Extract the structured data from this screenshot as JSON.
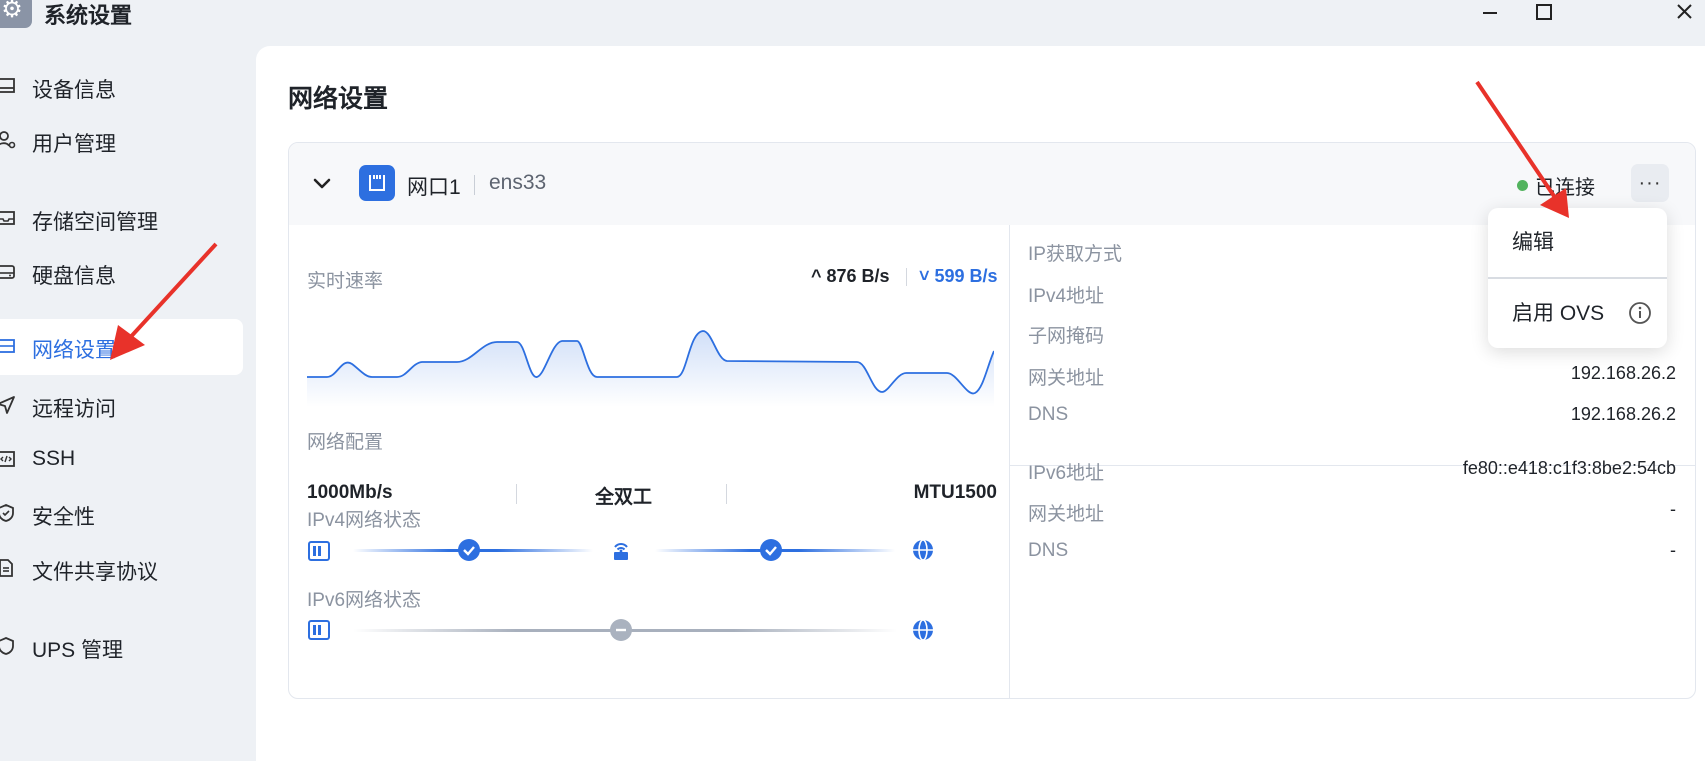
{
  "window": {
    "title": "系统设置",
    "icons": [
      "gear-icon",
      "minimize-icon",
      "maximize-icon",
      "close-icon"
    ]
  },
  "sidebar": {
    "items": [
      {
        "label": "设备信息",
        "icon": "device-icon"
      },
      {
        "label": "用户管理",
        "icon": "user-gear-icon"
      },
      {
        "label": "存储空间管理",
        "icon": "storage-icon"
      },
      {
        "label": "硬盘信息",
        "icon": "disk-icon"
      },
      {
        "label": "网络设置",
        "icon": "network-icon",
        "active": true
      },
      {
        "label": "远程访问",
        "icon": "send-icon"
      },
      {
        "label": "SSH",
        "icon": "code-icon"
      },
      {
        "label": "安全性",
        "icon": "shield-check-icon"
      },
      {
        "label": "文件共享协议",
        "icon": "file-icon"
      },
      {
        "label": "UPS 管理",
        "icon": "shield-icon"
      }
    ]
  },
  "main": {
    "title": "网络设置",
    "port": {
      "name": "网口1",
      "device": "ens33",
      "status": "已连接",
      "status_color": "#52b35e",
      "more_label": "···"
    },
    "realtime": {
      "label": "实时速率",
      "upload": "^ 876 B/s",
      "download": "˅ 599 B/s",
      "download_color": "#2d6fe0"
    },
    "config": {
      "label": "网络配置",
      "speed": "1000Mb/s",
      "duplex": "全双工",
      "mtu": "MTU1500"
    },
    "ipv4_status": {
      "label": "IPv4网络状态",
      "link1": "connected",
      "link2": "connected"
    },
    "ipv6_status": {
      "label": "IPv6网络状态",
      "link1": "disconnected"
    },
    "ipv4": {
      "method_label": "IP获取方式",
      "method_value": "",
      "address_label": "IPv4地址",
      "address_value": "",
      "mask_label": "子网掩码",
      "mask_value": "",
      "gateway_label": "网关地址",
      "gateway_value": "192.168.26.2",
      "dns_label": "DNS",
      "dns_value": "192.168.26.2"
    },
    "ipv6": {
      "address_label": "IPv6地址",
      "address_value": "fe80::e418:c1f3:8be2:54cb",
      "gateway_label": "网关地址",
      "gateway_value": "-",
      "dns_label": "DNS",
      "dns_value": "-"
    }
  },
  "dropdown": {
    "items": [
      {
        "label": "编辑"
      },
      {
        "label": "启用 OVS",
        "icon": "info-icon"
      }
    ]
  },
  "colors": {
    "accent": "#2d6fe0",
    "annotation_arrow": "#e8322a"
  }
}
